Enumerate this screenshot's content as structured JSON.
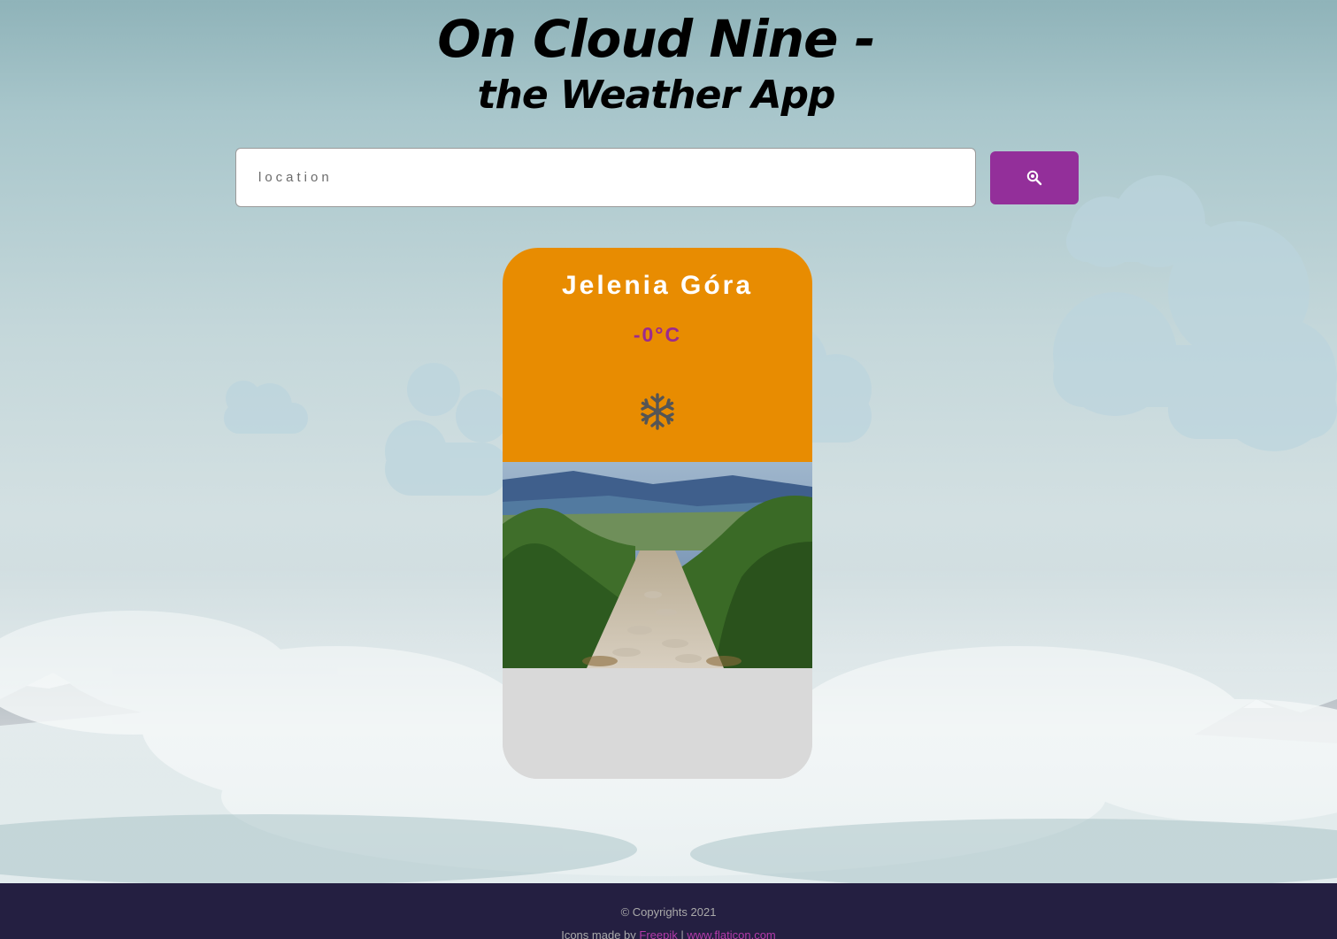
{
  "header": {
    "title_line1": "On Cloud Nine -",
    "title_line2": "the Weather App"
  },
  "search": {
    "placeholder": "location",
    "value": "",
    "button_icon": "search-icon"
  },
  "weather_card": {
    "city": "Jelenia Góra",
    "temperature": "-0°C",
    "condition_icon": "snowflake-icon",
    "photo": "mountain-trail-photo",
    "colors": {
      "top": "#e88c01",
      "temperature": "#9b2a8f",
      "bottom": "#d9d9d9"
    }
  },
  "footer": {
    "copyright": "© Copyrights 2021",
    "credits_prefix": "Icons made by ",
    "credits_author": "Freepik",
    "credits_separator": " | ",
    "credits_site": "www.flaticon.com"
  },
  "colors": {
    "accent": "#932f9a",
    "footer_bg": "#241f41"
  }
}
